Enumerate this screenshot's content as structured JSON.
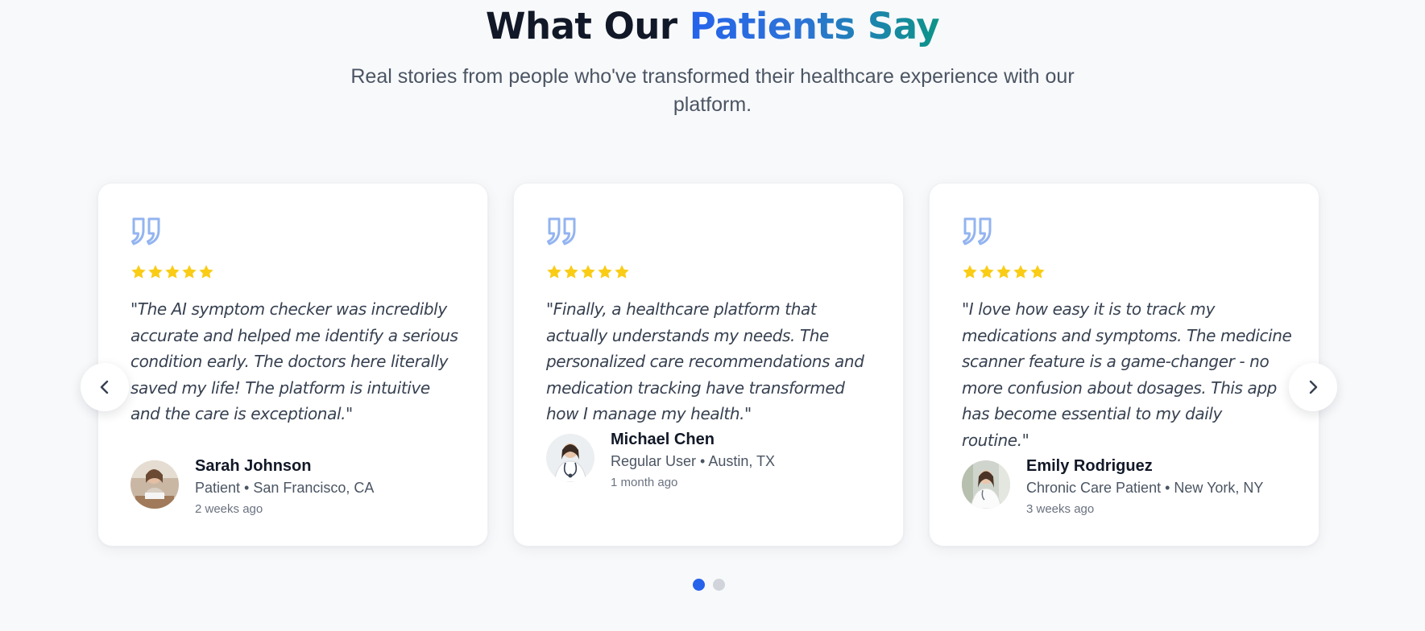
{
  "heading": {
    "prefix": "What Our ",
    "accent": "Patients Say"
  },
  "subtitle": "Real stories from people who've transformed their healthcare experience with our platform.",
  "colors": {
    "accent_blue": "#2563eb",
    "accent_teal": "#0d9488",
    "star": "#facc15",
    "quote_icon": "#93b4f0"
  },
  "testimonials": [
    {
      "rating": 5,
      "quote": "\"The AI symptom checker was incredibly accurate and helped me identify a serious condition early. The doctors here literally saved my life! The platform is intuitive and the care is exceptional.\"",
      "name": "Sarah Johnson",
      "role": "Patient • San Francisco, CA",
      "time": "2 weeks ago",
      "avatar_alt": "Sarah Johnson avatar"
    },
    {
      "rating": 5,
      "quote": "\"Finally, a healthcare platform that actually understands my needs. The personalized care recommendations and medication tracking have transformed how I manage my health.\"",
      "name": "Michael Chen",
      "role": "Regular User • Austin, TX",
      "time": "1 month ago",
      "avatar_alt": "Michael Chen avatar"
    },
    {
      "rating": 5,
      "quote": "\"I love how easy it is to track my medications and symptoms. The medicine scanner feature is a game-changer - no more confusion about dosages. This app has become essential to my daily routine.\"",
      "name": "Emily Rodriguez",
      "role": "Chronic Care Patient • New York, NY",
      "time": "3 weeks ago",
      "avatar_alt": "Emily Rodriguez avatar"
    }
  ],
  "carousel": {
    "prev_icon": "chevron-left-icon",
    "next_icon": "chevron-right-icon",
    "page_count": 2,
    "active_page": 1
  }
}
